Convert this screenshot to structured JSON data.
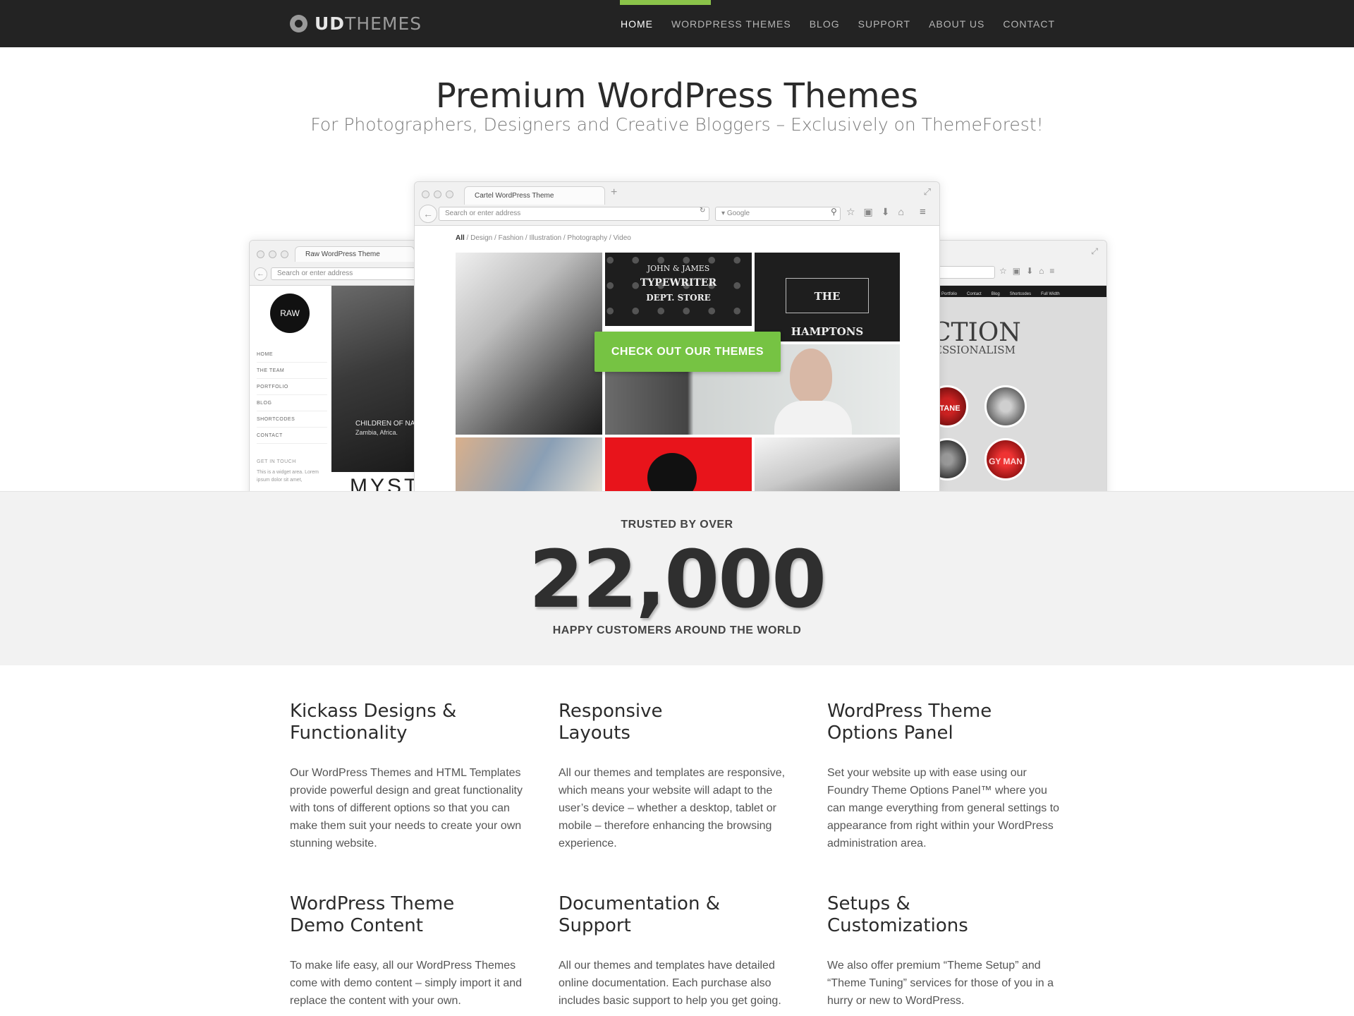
{
  "brand": {
    "logo_bold": "UD",
    "logo_light": "THEMES"
  },
  "nav": {
    "items": [
      {
        "label": "HOME",
        "active": true
      },
      {
        "label": "WORDPRESS THEMES",
        "active": false
      },
      {
        "label": "BLOG",
        "active": false
      },
      {
        "label": "SUPPORT",
        "active": false
      },
      {
        "label": "ABOUT US",
        "active": false
      },
      {
        "label": "CONTACT",
        "active": false
      }
    ]
  },
  "hero": {
    "title": "Premium WordPress Themes",
    "subtitle": "For Photographers, Designers and Creative Bloggers – Exclusively on ThemeForest!",
    "cta": "CHECK OUT OUR THEMES"
  },
  "mockups": {
    "left": {
      "tab": "Raw WordPress Theme",
      "address_placeholder": "Search or enter address",
      "logo": "RAW",
      "menu": [
        "HOME",
        "THE TEAM",
        "PORTFOLIO",
        "BLOG",
        "SHORTCODES",
        "CONTACT"
      ],
      "caption_title": "CHILDREN OF NA",
      "caption_sub": "Zambia, Africa.",
      "widget_title": "GET IN TOUCH",
      "widget_text": "This is a widget area. Lorem ipsum dolor sit amet,",
      "big_text": "MYST"
    },
    "center": {
      "tab": "Cartel WordPress Theme",
      "address_placeholder": "Search or enter address",
      "search_placeholder": "Google",
      "filter_active": "All",
      "filter_rest": " / Design / Fashion / Illustration / Photography / Video",
      "tile_typewriter_1": "JOHN & JAMES",
      "tile_typewriter_2": "TYPEWRITER",
      "tile_typewriter_3": "DEPT. STORE",
      "tile_hamptons": "THE HAMPTONS"
    },
    "right": {
      "menu": [
        "Portfolio",
        "Contact",
        "Blog",
        "Shortcodes",
        "Full Width"
      ],
      "big_text": "CTION",
      "small_text": "ESSIONALISM",
      "circle_1": "CTANE",
      "circle_2": "GY MAN"
    }
  },
  "stats": {
    "pre": "TRUSTED BY OVER",
    "number": "22,000",
    "post": "HAPPY CUSTOMERS AROUND THE WORLD"
  },
  "features": [
    {
      "title": "Kickass Designs &\nFunctionality",
      "text": "Our WordPress Themes and HTML Templates provide powerful design and great functionality with tons of different options so that you can make them suit your needs to create your own stunning website."
    },
    {
      "title": "Responsive\nLayouts",
      "text": "All our themes and templates are responsive, which means your website will adapt to the user’s device – whether a desktop, tablet or mobile – therefore enhancing the browsing experience."
    },
    {
      "title": "WordPress Theme\nOptions Panel",
      "text": "Set your website up with ease using our Foundry Theme Options Panel™ where you can mange everything from general settings to appearance from right within your WordPress administration area."
    },
    {
      "title": "WordPress Theme\nDemo Content",
      "text": "To make life easy, all our WordPress Themes come with demo content – simply import it and replace the content with your own."
    },
    {
      "title": "Documentation &\nSupport",
      "text": "All our themes and templates have detailed online documentation. Each purchase also includes basic support to help you get going."
    },
    {
      "title": "Setups &\nCustomizations",
      "text": "We also offer premium “Theme Setup” and “Theme Tuning” services for those of you in a hurry or new to WordPress."
    }
  ],
  "colors": {
    "accent": "#8bc34a",
    "cta": "#76c343",
    "nav_bg": "#232323",
    "band_bg": "#f2f2f2"
  }
}
